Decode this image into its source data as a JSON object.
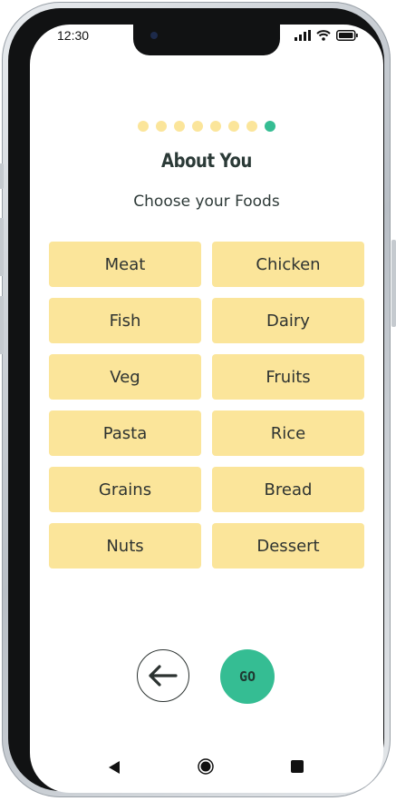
{
  "status_bar": {
    "time": "12:30"
  },
  "progress": {
    "total_steps": 8,
    "current_step": 8
  },
  "page": {
    "title": "About You",
    "subtitle": "Choose your Foods"
  },
  "foods": [
    "Meat",
    "Chicken",
    "Fish",
    "Dairy",
    "Veg",
    "Fruits",
    "Pasta",
    "Rice",
    "Grains",
    "Bread",
    "Nuts",
    "Dessert"
  ],
  "actions": {
    "back_icon": "arrow-left-icon",
    "go_label": "GO"
  },
  "nav": {
    "back_icon": "triangle-back-icon",
    "home_icon": "circle-home-icon",
    "recents_icon": "square-recents-icon"
  },
  "colors": {
    "option_bg": "#fbe59a",
    "accent": "#35bd93",
    "text": "#2e3331"
  }
}
